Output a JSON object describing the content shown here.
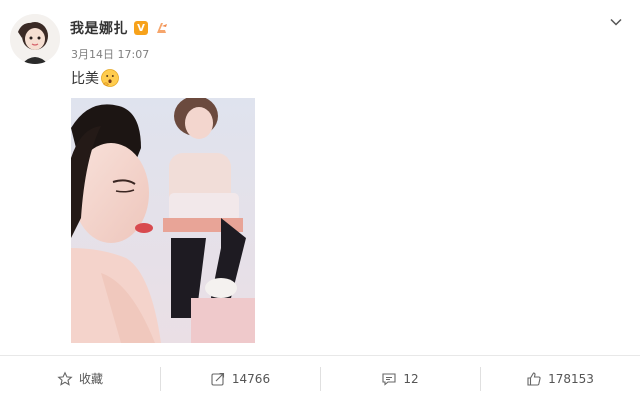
{
  "post": {
    "username": "我是娜扎",
    "verified_badge": "V",
    "timestamp": "3月14日 17:07",
    "text": "比美",
    "emoji": "thinking-face-emoji"
  },
  "toolbar": {
    "favorite_label": "收藏",
    "repost_count": "14766",
    "comment_count": "12",
    "like_count": "178153"
  },
  "colors": {
    "verified": "#f7a21b",
    "text": "#333333",
    "muted": "#808080"
  },
  "icons": {
    "favorite": "star-outline-icon",
    "repost": "share-out-icon",
    "comment": "comment-bubble-icon",
    "like": "thumbs-up-icon",
    "menu": "chevron-down-icon"
  }
}
